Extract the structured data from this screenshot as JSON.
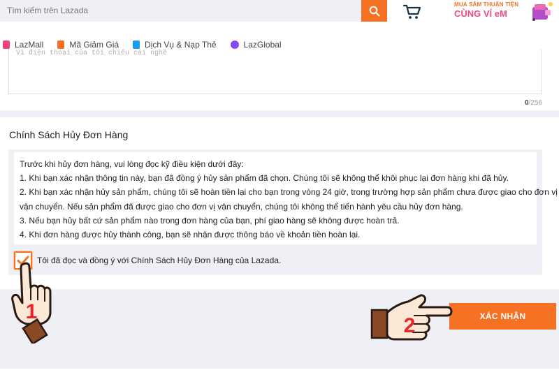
{
  "header": {
    "search_placeholder": "Tìm kiếm trên Lazada",
    "icons": {
      "search": "search-icon",
      "cart": "cart-icon"
    },
    "promo": {
      "line1": "MUA SẮM THUẬN TIỆN",
      "line2": "CÙNG VÍ eM"
    }
  },
  "nav": {
    "items": [
      {
        "label": "LazMall",
        "icon": "lazmall-icon",
        "color": "#f0457a"
      },
      {
        "label": "Mã Giảm Giá",
        "icon": "voucher-icon",
        "color": "#f57224"
      },
      {
        "label": "Dịch Vụ & Nạp Thẻ",
        "icon": "phone-topup-icon",
        "color": "#1a9cf0"
      },
      {
        "label": "LazGlobal",
        "icon": "lazglobal-icon",
        "color": "#8a48e8"
      }
    ]
  },
  "reason": {
    "ghost_text": "Vì điện thoại của tôi chiếu cái nghề",
    "counter_current": "0",
    "counter_max": "/256"
  },
  "policy": {
    "title": "Chính Sách Hủy Đơn Hàng",
    "lines": [
      "Trước khi hủy đơn hàng, vui lòng đọc kỹ điều kiện dưới đây:",
      "1. Khi bạn xác nhận thông tin này, bạn đã đồng ý hủy sản phẩm đã chọn. Chúng tôi sẽ không thể khôi phục lại đơn hàng khi đã hủy.",
      "2. Khi bạn xác nhận hủy sản phẩm, chúng tôi sẽ hoàn tiền lại cho bạn trong vòng 24 giờ, trong trường hợp sản phẩm chưa được giao cho đơn vị",
      "vận chuyển. Nếu sản phẩm đã được giao cho đơn vị vận chuyển, chúng tôi không thể tiến hành yêu cầu hủy đơn hàng.",
      "3. Nếu bạn hủy bất cứ sản phẩm nào trong đơn hàng của bạn, phí giao hàng sẽ không được hoàn trả.",
      "4. Khi đơn hàng được hủy thành công, bạn sẽ nhận được thông báo về khoản tiền hoàn lại."
    ],
    "agree_label": "Tôi đã đọc và đồng ý với Chính Sách Hủy Đơn Hàng của Lazada.",
    "agree_checked": true
  },
  "confirm_label": "XÁC NHẬN",
  "annotations": {
    "step1": "1",
    "step2": "2"
  },
  "colors": {
    "accent": "#f57224",
    "annotation_red": "#e8262a"
  }
}
